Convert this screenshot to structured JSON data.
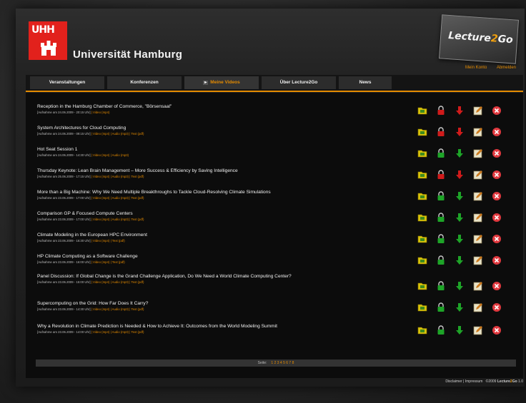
{
  "header": {
    "logo_text": "UHH",
    "university_name": "Universität Hamburg",
    "lecture2go_logo": {
      "part1": "Lecture",
      "part2": "2",
      "part3": "Go"
    },
    "top_links": [
      "Mein Konto",
      "Abmelden"
    ]
  },
  "nav": {
    "tabs": [
      {
        "label": "Veranstaltungen",
        "active": false
      },
      {
        "label": "Konferenzen",
        "active": false
      },
      {
        "label": "Meine Videos",
        "active": true
      },
      {
        "label": "Über Lecture2Go",
        "active": false
      },
      {
        "label": "News",
        "active": false
      }
    ]
  },
  "videos": [
    {
      "title": "Reception in the Hamburg Chamber of Commerce, \"Börsensaal\"",
      "meta": "[Aufnahme am 24.06.2009 - 20:15 Uhr]",
      "links": "| Video (mp4)",
      "locked": true
    },
    {
      "title": "System Architectures for Cloud Computing",
      "meta": "[Aufnahme am 24.06.2009 - 09:15 Uhr]",
      "links": "| Video (mp4) | Audio (mp3) | Text (pdf)",
      "locked": true
    },
    {
      "title": "Hot Seat Session 1",
      "meta": "[Aufnahme am 24.06.2009 - 14:30 Uhr]",
      "links": "| Video (mp4) | Audio (mp3)",
      "locked": false
    },
    {
      "title": "Thursday Keynote: Lean Brain Management – More Success & Efficiency by Saving Intelligence",
      "meta": "[Aufnahme am 25.06.2009 - 17:15 Uhr]",
      "links": "| Video (mp4) | Audio (mp3) | Text (pdf)",
      "locked": true
    },
    {
      "title": "More than a Big Machine: Why We Need Multiple Breakthroughs to Tackle Cloud-Resolving Climate Simulations",
      "meta": "[Aufnahme am 23.06.2009 - 17:00 Uhr]",
      "links": "| Video (mp4) | Audio (mp3) | Text (pdf)",
      "locked": false
    },
    {
      "title": "Comparison GP & Focused Compute Centers",
      "meta": "[Aufnahme am 23.06.2009 - 17:00 Uhr]",
      "links": "| Video (mp4) | Audio (mp3) | Text (pdf)",
      "locked": false
    },
    {
      "title": "Climate Modeling in the European HPC Environment",
      "meta": "[Aufnahme am 23.06.2009 - 16:30 Uhr]",
      "links": "| Video (mp4) | Text (pdf)",
      "locked": false
    },
    {
      "title": "HP Climate Computing as a Software Challenge",
      "meta": "[Aufnahme am 23.06.2009 - 16:00 Uhr]",
      "links": "| Video (mp4) | Text (pdf)",
      "locked": false
    },
    {
      "title": "Panel Discussion: If Global Change is the Grand Challenge Application, Do We Need a World Climate Computing Center?",
      "meta": "[Aufnahme am 23.06.2009 - 15:00 Uhr]",
      "links": "| Video (mp4) | Audio (mp3) | Text (pdf)",
      "locked": false
    },
    {
      "title": "Supercomputing on the Grid: How Far Does It Carry?",
      "meta": "[Aufnahme am 23.06.2009 - 14:30 Uhr]",
      "links": "| Video (mp4) | Audio (mp3) | Text (pdf)",
      "locked": false
    },
    {
      "title": "Why a Revolution in Climate Prediction is Needed & How to Achieve It: Outcomes from the World Modeling Summit",
      "meta": "[Aufnahme am 23.06.2009 - 14:00 Uhr]",
      "links": "| Video (mp4) | Audio (mp3) | Text (pdf)",
      "locked": false
    }
  ],
  "pagination": {
    "label": "Seite:",
    "pages": "1 2 3 4 5 6 7 8"
  },
  "footer": {
    "disclaimer": "Disclaimer",
    "sep": "|",
    "impressum": "Impressum",
    "copyright": "©2009",
    "brand_part1": "Lecture",
    "brand_part2": "2",
    "brand_part3": "Go",
    "version": "1.0"
  },
  "colors": {
    "accent": "#e58b00",
    "unlocked": "#1ea428",
    "locked": "#d01b1b",
    "delete": "#e0383e"
  }
}
